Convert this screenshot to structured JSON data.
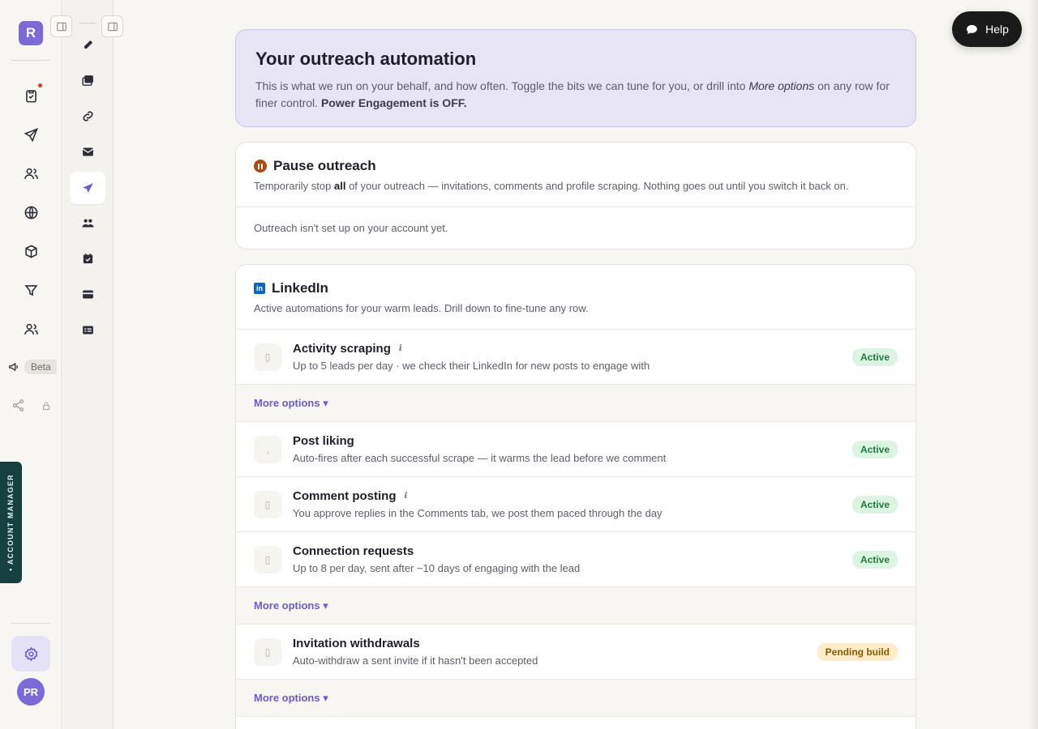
{
  "app": {
    "logo_letter": "R",
    "beta_label": "Beta",
    "account_manager_label": "• ACCOUNT MANAGER",
    "avatar_initials": "PR",
    "help_label": "Help"
  },
  "hero": {
    "title": "Your outreach automation",
    "desc_part1": "This is what we run on your behalf, and how often. Toggle the bits we can tune for you, or drill into ",
    "desc_emphasis": "More options",
    "desc_part2": " on any row for finer control. ",
    "desc_strong": "Power Engagement is OFF."
  },
  "pause": {
    "title": "Pause outreach",
    "desc_part1": "Temporarily stop ",
    "desc_bold": "all",
    "desc_part2": " of your outreach — invitations, comments and profile scraping. Nothing goes out until you switch it back on.",
    "note": "Outreach isn't set up on your account yet."
  },
  "linkedin": {
    "icon_text": "in",
    "title": "LinkedIn",
    "subtitle": "Active automations for your warm leads. Drill down to fine-tune any row.",
    "more_options_label": "More options ▾",
    "rows": [
      {
        "title": "Activity scraping",
        "info": "i",
        "desc": "Up to 5 leads per day · we check their LinkedIn for new posts to engage with",
        "status": "Active"
      },
      {
        "title": "Post liking",
        "desc": "Auto-fires after each successful scrape — it warms the lead before we comment",
        "status": "Active"
      },
      {
        "title": "Comment posting",
        "info": "i",
        "desc": "You approve replies in the Comments tab, we post them paced through the day",
        "status": "Active"
      },
      {
        "title": "Connection requests",
        "desc": "Up to 8 per day, sent after ~10 days of engaging with the lead",
        "status": "Active"
      },
      {
        "title": "Invitation withdrawals",
        "desc": "Auto-withdraw a sent invite if it hasn't been accepted",
        "status": "Pending build"
      }
    ]
  },
  "colors": {
    "accent": "#6b5bd2",
    "active_bg": "#dcf5e3",
    "pending_bg": "#fcecc7"
  }
}
